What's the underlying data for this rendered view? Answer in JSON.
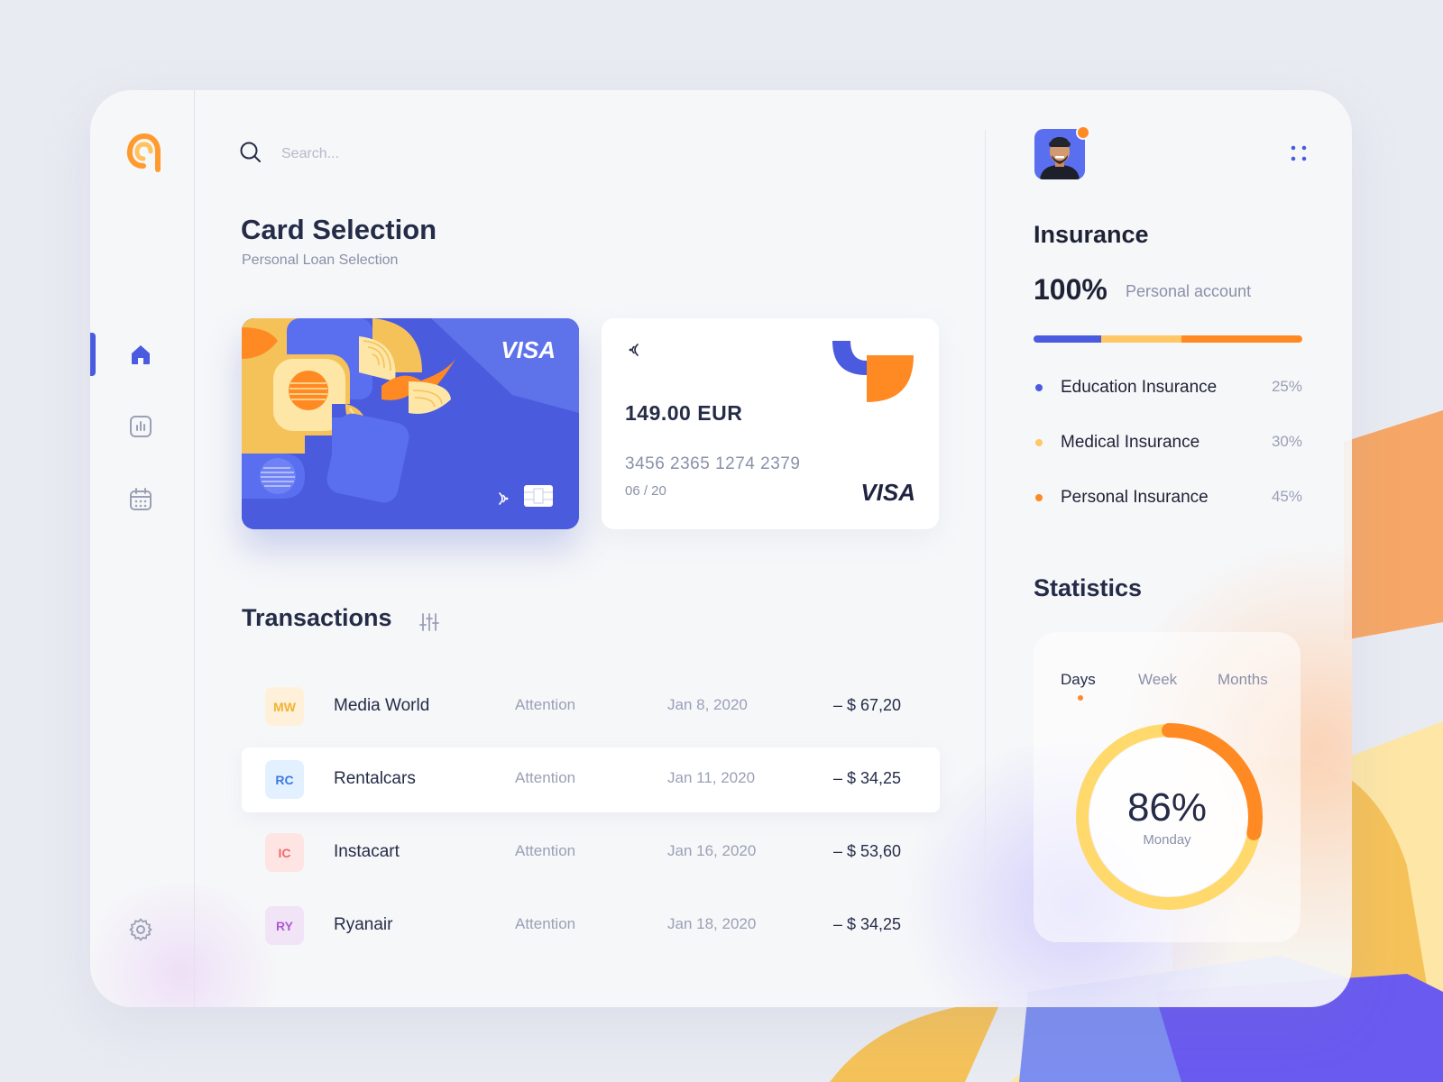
{
  "app": {
    "logo": "brand-logo"
  },
  "sidebar": {
    "items": [
      {
        "name": "home",
        "icon": "home-icon",
        "active": true
      },
      {
        "name": "analytics",
        "icon": "bar-chart-icon",
        "active": false
      },
      {
        "name": "calendar",
        "icon": "calendar-icon",
        "active": false
      },
      {
        "name": "settings",
        "icon": "gear-icon",
        "active": false
      }
    ]
  },
  "search": {
    "placeholder": "Search...",
    "icon": "search-icon"
  },
  "main": {
    "title": "Card Selection",
    "subtitle": "Personal Loan Selection",
    "cards": {
      "primary": {
        "brand": "VISA",
        "color": "#4a5bdd"
      },
      "secondary": {
        "brand": "VISA",
        "amount": "149.00 EUR",
        "number": "3456 2365 1274 2379",
        "expiry": "06 / 20"
      }
    },
    "transactions": {
      "title": "Transactions",
      "filter_icon": "sliders-icon",
      "rows": [
        {
          "badge": "MW",
          "name": "Media World",
          "status": "Attention",
          "date": "Jan 8, 2020",
          "amount": "– $ 67,20",
          "badge_bg": "#fff1d9",
          "badge_fg": "#f2b233",
          "highlight": false
        },
        {
          "badge": "RC",
          "name": "Rentalcars",
          "status": "Attention",
          "date": "Jan 11, 2020",
          "amount": "– $ 34,25",
          "badge_bg": "#e3f0ff",
          "badge_fg": "#3d7be0",
          "highlight": true
        },
        {
          "badge": "IC",
          "name": "Instacart",
          "status": "Attention",
          "date": "Jan 16, 2020",
          "amount": "– $ 53,60",
          "badge_bg": "#ffe4e4",
          "badge_fg": "#f06a6a",
          "highlight": false
        },
        {
          "badge": "RY",
          "name": "Ryanair",
          "status": "Attention",
          "date": "Jan 18, 2020",
          "amount": "– $ 34,25",
          "badge_bg": "#f1e4f7",
          "badge_fg": "#b15ad0",
          "highlight": false
        }
      ]
    }
  },
  "right": {
    "profile": {
      "avatar": "user-avatar",
      "notification": true,
      "menu_icon": "dots-grid-icon"
    },
    "insurance": {
      "title": "Insurance",
      "percent": "100%",
      "account": "Personal account",
      "segments": [
        {
          "fraction": 0.25,
          "color": "#4a5be0"
        },
        {
          "fraction": 0.3,
          "color": "#ffc766"
        },
        {
          "fraction": 0.45,
          "color": "#ff8a24"
        }
      ],
      "items": [
        {
          "label": "Education Insurance",
          "value": "25%",
          "color": "#4a5be0"
        },
        {
          "label": "Medical Insurance",
          "value": "30%",
          "color": "#ffc766"
        },
        {
          "label": "Personal Insurance",
          "value": "45%",
          "color": "#ff8a24"
        }
      ]
    },
    "statistics": {
      "title": "Statistics",
      "tabs": [
        "Days",
        "Week",
        "Months"
      ],
      "active_tab": "Days",
      "percent": "86%",
      "day": "Monday",
      "value": 0.86
    }
  }
}
